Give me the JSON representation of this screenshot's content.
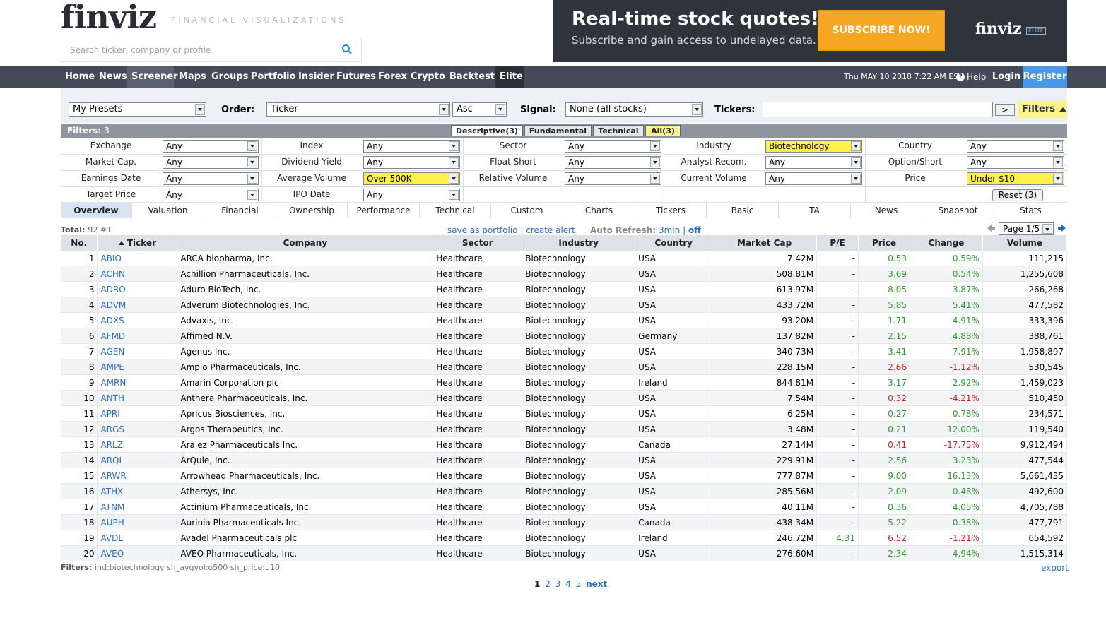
{
  "header": {
    "logo": "finviz",
    "tagline": "FINANCIAL VISUALIZATIONS",
    "search_placeholder": "Search ticker, company or profile"
  },
  "ad": {
    "headline": "Real-time stock quotes!",
    "sub": "Subscribe and gain access to undelayed data.",
    "button": "SUBSCRIBE NOW!",
    "logo": "finviz",
    "badge": "ELITE"
  },
  "nav": {
    "items": [
      "Home",
      "News",
      "Screener",
      "Maps",
      "Groups",
      "Portfolio",
      "Insider",
      "Futures",
      "Forex",
      "Crypto",
      "Backtests",
      "Elite"
    ],
    "active": "Screener",
    "datetime": "Thu MAY 10 2018 7:22 AM EST",
    "help": "Help",
    "login": "Login",
    "register": "Register"
  },
  "panel": {
    "presets": "My Presets",
    "order_label": "Order:",
    "order_value": "Ticker",
    "order_dir": "Asc",
    "signal_label": "Signal:",
    "signal_value": "None (all stocks)",
    "tickers_label": "Tickers:",
    "tickers_value": "",
    "go": ">",
    "filters_toggle": "Filters"
  },
  "filterbar": {
    "label": "Filters:",
    "count": "3",
    "tabs": [
      "Descriptive(3)",
      "Fundamental",
      "Technical",
      "All(3)"
    ]
  },
  "filters": [
    [
      [
        "Exchange",
        "Any"
      ],
      [
        "Index",
        "Any"
      ],
      [
        "Sector",
        "Any"
      ],
      [
        "Industry",
        "Biotechnology"
      ],
      [
        "Country",
        "Any"
      ]
    ],
    [
      [
        "Market Cap.",
        "Any"
      ],
      [
        "Dividend Yield",
        "Any"
      ],
      [
        "Float Short",
        "Any"
      ],
      [
        "Analyst Recom.",
        "Any"
      ],
      [
        "Option/Short",
        "Any"
      ]
    ],
    [
      [
        "Earnings Date",
        "Any"
      ],
      [
        "Average Volume",
        "Over 500K"
      ],
      [
        "Relative Volume",
        "Any"
      ],
      [
        "Current Volume",
        "Any"
      ],
      [
        "Price",
        "Under $10"
      ]
    ],
    [
      [
        "Target Price",
        "Any"
      ],
      [
        "IPO Date",
        "Any"
      ]
    ]
  ],
  "reset": "Reset (3)",
  "views": [
    "Overview",
    "Valuation",
    "Financial",
    "Ownership",
    "Performance",
    "Technical",
    "Custom",
    "Charts",
    "Tickers",
    "Basic",
    "TA",
    "News",
    "Snapshot",
    "Stats"
  ],
  "summary": {
    "total_label": "Total:",
    "total_value": "92 #1",
    "save_portfolio": "save as portfolio",
    "sep": "|",
    "create_alert": "create alert",
    "auto_refresh": "Auto Refresh:",
    "refresh_3min": "3min",
    "refresh_off": "off",
    "page": "Page 1/5"
  },
  "table": {
    "headers": [
      "No.",
      "Ticker",
      "Company",
      "Sector",
      "Industry",
      "Country",
      "Market Cap",
      "P/E",
      "Price",
      "Change",
      "Volume"
    ],
    "rows": [
      [
        "1",
        "ABIO",
        "ARCA biopharma, Inc.",
        "Healthcare",
        "Biotechnology",
        "USA",
        "7.42M",
        "-",
        "0.53",
        "0.59%",
        "111,215"
      ],
      [
        "2",
        "ACHN",
        "Achillion Pharmaceuticals, Inc.",
        "Healthcare",
        "Biotechnology",
        "USA",
        "508.81M",
        "-",
        "3.69",
        "0.54%",
        "1,255,608"
      ],
      [
        "3",
        "ADRO",
        "Aduro BioTech, Inc.",
        "Healthcare",
        "Biotechnology",
        "USA",
        "613.97M",
        "-",
        "8.05",
        "3.87%",
        "266,268"
      ],
      [
        "4",
        "ADVM",
        "Adverum Biotechnologies, Inc.",
        "Healthcare",
        "Biotechnology",
        "USA",
        "433.72M",
        "-",
        "5.85",
        "5.41%",
        "477,582"
      ],
      [
        "5",
        "ADXS",
        "Advaxis, Inc.",
        "Healthcare",
        "Biotechnology",
        "USA",
        "93.20M",
        "-",
        "1.71",
        "4.91%",
        "333,396"
      ],
      [
        "6",
        "AFMD",
        "Affimed N.V.",
        "Healthcare",
        "Biotechnology",
        "Germany",
        "137.82M",
        "-",
        "2.15",
        "4.88%",
        "388,761"
      ],
      [
        "7",
        "AGEN",
        "Agenus Inc.",
        "Healthcare",
        "Biotechnology",
        "USA",
        "340.73M",
        "-",
        "3.41",
        "7.91%",
        "1,958,897"
      ],
      [
        "8",
        "AMPE",
        "Ampio Pharmaceuticals, Inc.",
        "Healthcare",
        "Biotechnology",
        "USA",
        "228.15M",
        "-",
        "2.66",
        "-1.12%",
        "530,545"
      ],
      [
        "9",
        "AMRN",
        "Amarin Corporation plc",
        "Healthcare",
        "Biotechnology",
        "Ireland",
        "844.81M",
        "-",
        "3.17",
        "2.92%",
        "1,459,023"
      ],
      [
        "10",
        "ANTH",
        "Anthera Pharmaceuticals, Inc.",
        "Healthcare",
        "Biotechnology",
        "USA",
        "7.54M",
        "-",
        "0.32",
        "-4.21%",
        "510,450"
      ],
      [
        "11",
        "APRI",
        "Apricus Biosciences, Inc.",
        "Healthcare",
        "Biotechnology",
        "USA",
        "6.25M",
        "-",
        "0.27",
        "0.78%",
        "234,571"
      ],
      [
        "12",
        "ARGS",
        "Argos Therapeutics, Inc.",
        "Healthcare",
        "Biotechnology",
        "USA",
        "3.48M",
        "-",
        "0.21",
        "12.00%",
        "119,540"
      ],
      [
        "13",
        "ARLZ",
        "Aralez Pharmaceuticals Inc.",
        "Healthcare",
        "Biotechnology",
        "Canada",
        "27.14M",
        "-",
        "0.41",
        "-17.75%",
        "9,912,494"
      ],
      [
        "14",
        "ARQL",
        "ArQule, Inc.",
        "Healthcare",
        "Biotechnology",
        "USA",
        "229.91M",
        "-",
        "2.56",
        "3.23%",
        "477,544"
      ],
      [
        "15",
        "ARWR",
        "Arrowhead Pharmaceuticals, Inc.",
        "Healthcare",
        "Biotechnology",
        "USA",
        "777.87M",
        "-",
        "9.00",
        "16.13%",
        "5,661,435"
      ],
      [
        "16",
        "ATHX",
        "Athersys, Inc.",
        "Healthcare",
        "Biotechnology",
        "USA",
        "285.56M",
        "-",
        "2.09",
        "0.48%",
        "492,600"
      ],
      [
        "17",
        "ATNM",
        "Actinium Pharmaceuticals, Inc.",
        "Healthcare",
        "Biotechnology",
        "USA",
        "40.11M",
        "-",
        "0.36",
        "4.05%",
        "4,705,788"
      ],
      [
        "18",
        "AUPH",
        "Aurinia Pharmaceuticals Inc.",
        "Healthcare",
        "Biotechnology",
        "Canada",
        "438.34M",
        "-",
        "5.22",
        "0.38%",
        "477,791"
      ],
      [
        "19",
        "AVDL",
        "Avadel Pharmaceuticals plc",
        "Healthcare",
        "Biotechnology",
        "Ireland",
        "246.72M",
        "4.31",
        "6.52",
        "-1.21%",
        "654,592"
      ],
      [
        "20",
        "AVEO",
        "AVEO Pharmaceuticals, Inc.",
        "Healthcare",
        "Biotechnology",
        "USA",
        "276.60M",
        "-",
        "2.34",
        "4.94%",
        "1,515,314"
      ]
    ]
  },
  "footer": {
    "filters_label": "Filters:",
    "filters_value": "ind:biotechnology sh_avgvol:o500 sh_price:u10",
    "export": "export",
    "pages": [
      "1",
      "2",
      "3",
      "4",
      "5"
    ],
    "next": "next"
  },
  "colors": {
    "nav_bg": "#444a57",
    "register_bg": "#4b97e8",
    "highlight": "#fff14a",
    "positive": "#2f9a2f",
    "negative": "#d32020",
    "link": "#2a6bc5"
  }
}
